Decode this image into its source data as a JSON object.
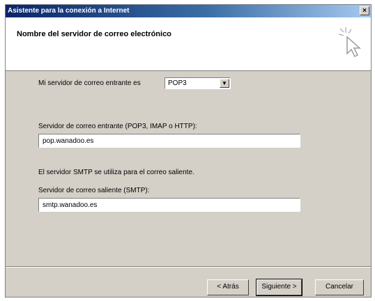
{
  "window": {
    "title": "Asistente para la conexión a Internet",
    "close_label": "×"
  },
  "header": {
    "title": "Nombre del servidor de correo electrónico"
  },
  "incoming_type": {
    "label": "Mi servidor de correo entrante es",
    "selected": "POP3",
    "arrow": "▼"
  },
  "incoming_server": {
    "label": "Servidor de correo entrante (POP3, IMAP o HTTP):",
    "value": "pop.wanadoo.es"
  },
  "smtp_note": "El servidor SMTP se utiliza para el correo saliente.",
  "outgoing_server": {
    "label": "Servidor de correo saliente (SMTP):",
    "value": "smtp.wanadoo.es"
  },
  "buttons": {
    "back": "< Atrás",
    "next": "Siguiente >",
    "cancel": "Cancelar"
  }
}
